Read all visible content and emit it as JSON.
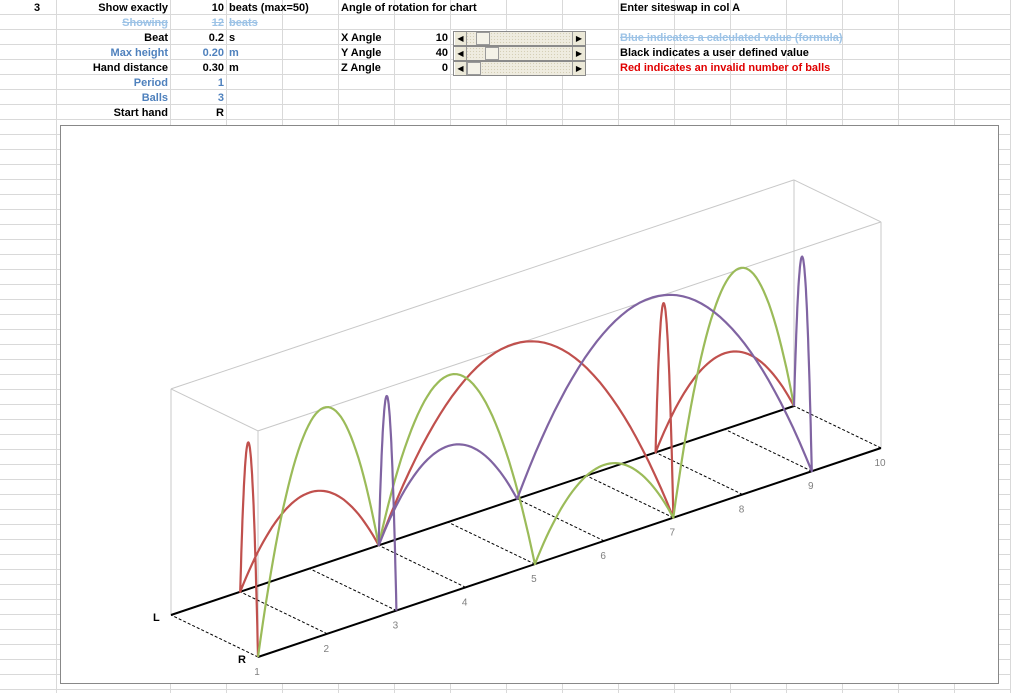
{
  "params": {
    "siteswap_cell": "3",
    "show_exactly": {
      "label": "Show exactly",
      "value": "10",
      "unit": "beats (max=50)"
    },
    "showing": {
      "label": "Showing",
      "value": "12",
      "unit": "beats"
    },
    "beat": {
      "label": "Beat",
      "value": "0.2",
      "unit": "s"
    },
    "max_height": {
      "label": "Max height",
      "value": "0.20",
      "unit": "m"
    },
    "hand_distance": {
      "label": "Hand distance",
      "value": "0.30",
      "unit": "m"
    },
    "period": {
      "label": "Period",
      "value": "1"
    },
    "balls": {
      "label": "Balls",
      "value": "3"
    },
    "start_hand": {
      "label": "Start hand",
      "value": "R"
    }
  },
  "rotation": {
    "title": "Angle of rotation for chart",
    "x": {
      "label": "X Angle",
      "value": "10",
      "level": 0.1
    },
    "y": {
      "label": "Y Angle",
      "value": "40",
      "level": 0.2
    },
    "z": {
      "label": "Z Angle",
      "value": "0",
      "level": 0
    }
  },
  "legend": {
    "instruction": "Enter siteswap in col A",
    "blue": "Blue indicates a calculated value (formula)",
    "black": "Black indicates a user defined value",
    "red": "Red indicates an invalid number of balls"
  },
  "icons": {
    "scroll_left": "arrow-left-icon",
    "scroll_right": "arrow-right-icon"
  },
  "colors": {
    "calculated": "#4f81bd",
    "invalid": "#e00000",
    "ball_red": "#c0504d",
    "ball_green": "#9bbb59",
    "ball_purple": "#8064a2"
  },
  "chart_data": {
    "type": "line",
    "view": "3d",
    "hands": {
      "left": "L",
      "right": "R"
    },
    "x_ticks": [
      "1",
      "2",
      "3",
      "4",
      "5",
      "6",
      "7",
      "8",
      "9",
      "10"
    ],
    "beat_time_s": 0.2,
    "max_height_m": 0.2,
    "hand_distance_m": 0.3,
    "series": [
      {
        "color": "#c0504d",
        "throws": [
          {
            "from": 1,
            "to": 2,
            "height": 0.19
          },
          {
            "from": 2,
            "to": 4,
            "height": 0.08
          },
          {
            "from": 4,
            "to": 7,
            "height": 0.2
          },
          {
            "from": 7,
            "to": 8,
            "height": 0.19
          },
          {
            "from": 8,
            "to": 10,
            "height": 0.08
          }
        ]
      },
      {
        "color": "#9bbb59",
        "throws": [
          {
            "from": 1,
            "to": 4,
            "height": 0.2
          },
          {
            "from": 4,
            "to": 5,
            "height": 0.19
          },
          {
            "from": 5,
            "to": 7,
            "height": 0.08
          },
          {
            "from": 7,
            "to": 10,
            "height": 0.2
          }
        ]
      },
      {
        "color": "#8064a2",
        "throws": [
          {
            "from": 3,
            "to": 4,
            "height": 0.19
          },
          {
            "from": 4,
            "to": 6,
            "height": 0.08
          },
          {
            "from": 6,
            "to": 9,
            "height": 0.2
          },
          {
            "from": 9,
            "to": 10,
            "height": 0.19
          }
        ]
      }
    ]
  }
}
